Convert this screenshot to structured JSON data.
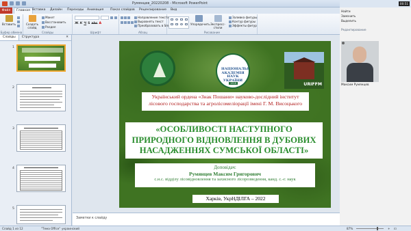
{
  "window": {
    "title": "Румянцев_20220208 - Microsoft PowerPoint",
    "time": "00:51"
  },
  "menu": {
    "file": "Файл",
    "tabs": [
      "Главная",
      "Вставка",
      "Дизайн",
      "Переходы",
      "Анимация",
      "Показ слайдов",
      "Рецензирование",
      "Вид"
    ],
    "active": "Главная"
  },
  "ribbon": {
    "clipboard": {
      "paste": "Вставить",
      "label": "Буфер обмена"
    },
    "slides": {
      "new_slide": "Создать слайд",
      "layout": "Макет",
      "reset": "Восстановить",
      "section": "Раздел",
      "label": "Слайды"
    },
    "font": {
      "label": "Шрифт"
    },
    "paragraph": {
      "text_direction": "Направление текста",
      "align_text": "Выровнять текст",
      "convert_smartart": "Преобразовать в SmartArt",
      "label": "Абзац"
    },
    "drawing": {
      "arrange": "Упорядочить",
      "quick_styles": "Экспресс-стили",
      "shape_fill": "Заливка фигуры",
      "shape_outline": "Контур фигуры",
      "shape_effects": "Эффекты фигур",
      "label": "Рисование"
    },
    "editing": {
      "find": "Найти",
      "replace": "Заменить",
      "select": "Выделить",
      "label": "Редактирование"
    }
  },
  "left_panel": {
    "tabs": [
      "Слайды",
      "Структура"
    ],
    "slide_numbers": [
      "1",
      "2",
      "3",
      "4",
      "5"
    ]
  },
  "slide": {
    "institute": "Український ордена «Знак Пошани» науково-дослідний інститут лісового господарства та агролісомеліорації імені Г. М. Висоцького",
    "title": "«ОСОБЛИВОСТІ НАСТУПНОГО ПРИРОДНОГО ВІДНОВЛЕННЯ В ДУБОВИХ НАСАДЖЕННЯХ СУМСЬКОЇ ОБЛАСТІ»",
    "speaker_label": "Доповідач:",
    "speaker_name": "Румянцев Максим Григорович",
    "speaker_role": "с.н.с. відділу лісовідновлення та захисного лісорозведення, канд. с.-г. наук",
    "place_year": "Харків, УкрНДІЛГА – 2022",
    "logo_academy_text": "НАЦІОНАЛЬНА АКАДЕМІЯ НАУК УКРАЇНИ",
    "logo_academy_year": "1918",
    "photo_watermark": "URIFFM"
  },
  "notes": {
    "placeholder": "Заметки к слайду"
  },
  "video": {
    "participant": "Максим Румянцев"
  },
  "status": {
    "slide_counter": "Слайд 1 из 12",
    "theme": "\"Тема Office\"",
    "language": "украинский",
    "zoom": "87%"
  }
}
